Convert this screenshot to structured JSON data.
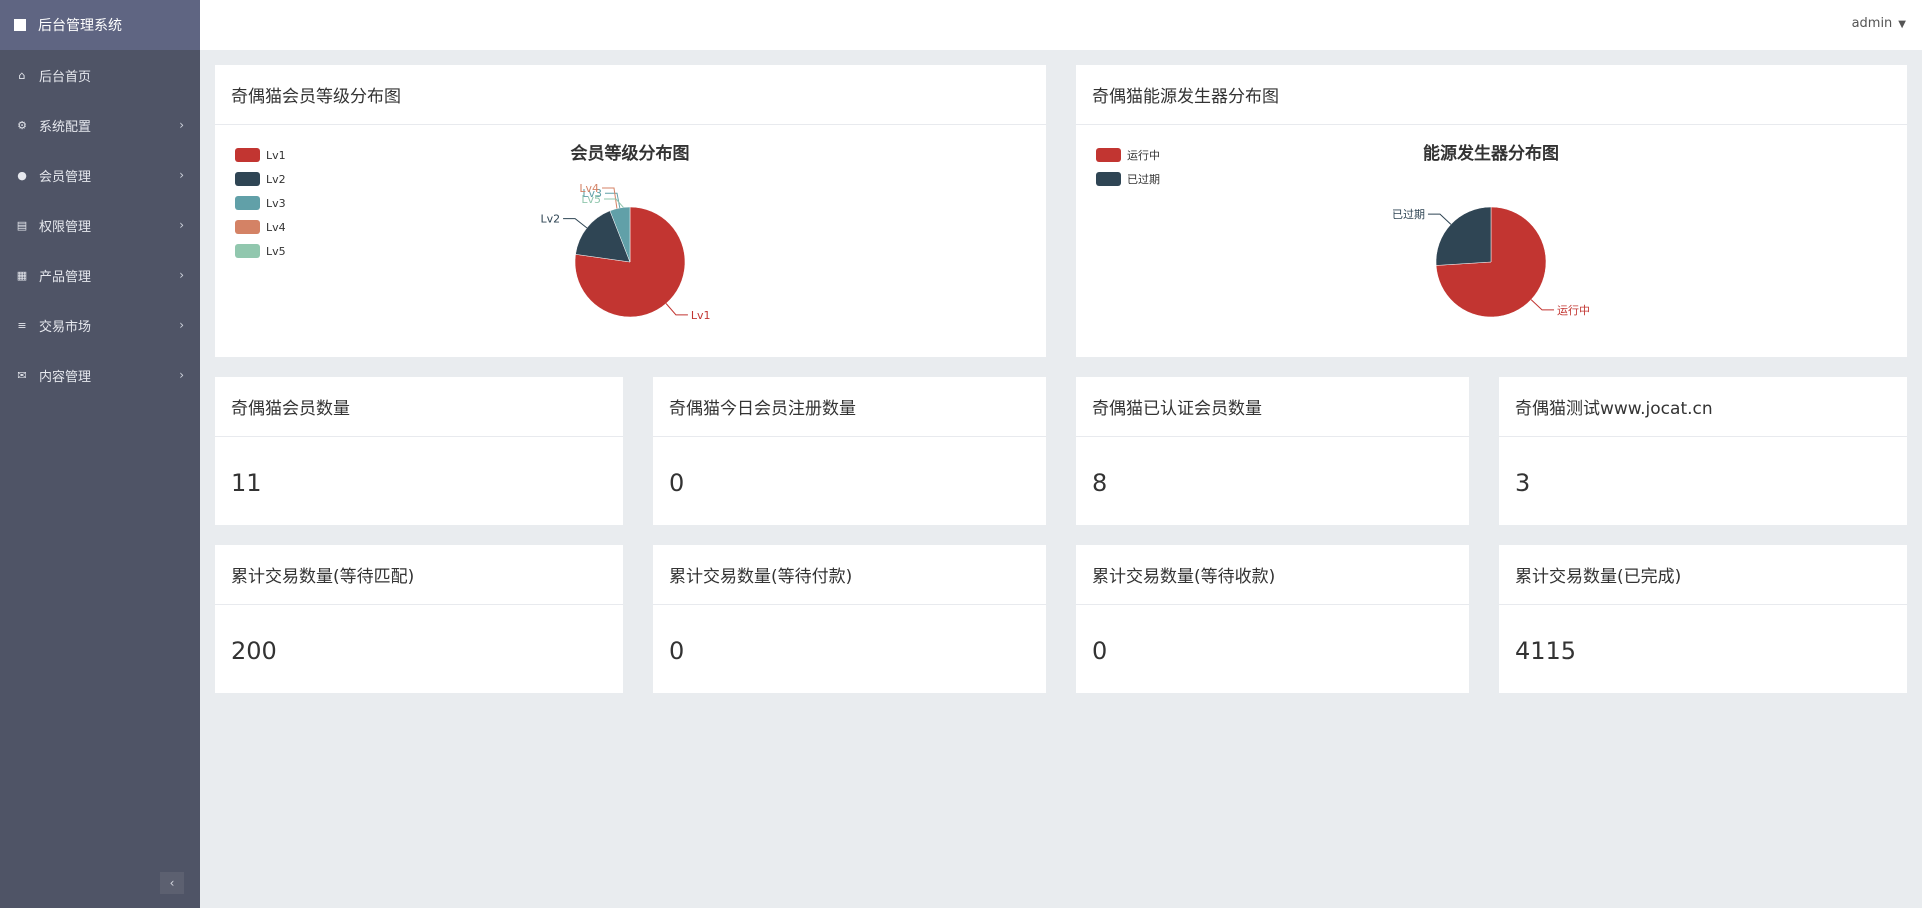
{
  "app": {
    "title": "后台管理系统"
  },
  "sidebar": {
    "items": [
      {
        "label": "后台首页",
        "icon": "home-icon",
        "has_children": false
      },
      {
        "label": "系统配置",
        "icon": "cogs-icon",
        "has_children": true
      },
      {
        "label": "会员管理",
        "icon": "user-icon",
        "has_children": true
      },
      {
        "label": "权限管理",
        "icon": "card-icon",
        "has_children": true
      },
      {
        "label": "产品管理",
        "icon": "windows-icon",
        "has_children": true
      },
      {
        "label": "交易市场",
        "icon": "list-icon",
        "has_children": true
      },
      {
        "label": "内容管理",
        "icon": "envelope-icon",
        "has_children": true
      }
    ],
    "collapse_label": "‹"
  },
  "topbar": {
    "user": "admin"
  },
  "charts": [
    {
      "card_title": "奇偶猫会员等级分布图",
      "chart_data": {
        "type": "pie",
        "title": "会员等级分布图",
        "categories": [
          "Lv1",
          "Lv2",
          "Lv3",
          "Lv4",
          "Lv5"
        ],
        "values": [
          78,
          17,
          6,
          0,
          0
        ],
        "colors": [
          "#c23531",
          "#2f4554",
          "#61a0a8",
          "#d48265",
          "#91c7ae"
        ],
        "legend": "top-left"
      }
    },
    {
      "card_title": "奇偶猫能源发生器分布图",
      "chart_data": {
        "type": "pie",
        "title": "能源发生器分布图",
        "categories": [
          "运行中",
          "已过期"
        ],
        "values": [
          74,
          26
        ],
        "colors": [
          "#c23531",
          "#2f4554"
        ],
        "legend": "top-left"
      }
    }
  ],
  "stats_row1": [
    {
      "title": "奇偶猫会员数量",
      "value": "11"
    },
    {
      "title": "奇偶猫今日会员注册数量",
      "value": "0"
    },
    {
      "title": "奇偶猫已认证会员数量",
      "value": "8"
    },
    {
      "title": "奇偶猫测试www.jocat.cn",
      "value": "3"
    }
  ],
  "stats_row2": [
    {
      "title": "累计交易数量(等待匹配)",
      "value": "200"
    },
    {
      "title": "累计交易数量(等待付款)",
      "value": "0"
    },
    {
      "title": "累计交易数量(等待收款)",
      "value": "0"
    },
    {
      "title": "累计交易数量(已完成)",
      "value": "4115"
    }
  ]
}
